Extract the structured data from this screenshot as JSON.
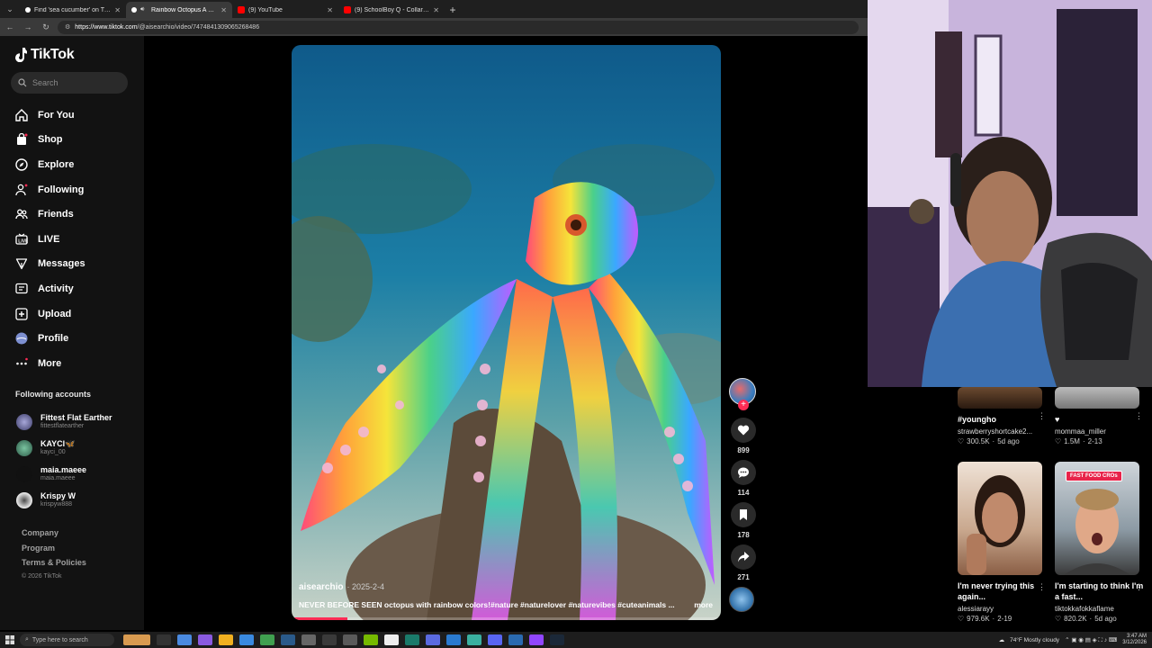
{
  "browser": {
    "tabs": [
      {
        "title": "Find 'sea cucumber' on TikTok | Ti",
        "color": "#111111"
      },
      {
        "title": "Rainbow Octopus A Nature Mo",
        "color": "#111111",
        "active": true
      },
      {
        "title": "(9) YouTube",
        "color": "#ff0000"
      },
      {
        "title": "(9) SchoolBoy Q - Collard Greens",
        "color": "#ff0000"
      }
    ],
    "url_host": "https://www.tiktok.com",
    "url_path": "/@aisearchio/video/7474841309065268486"
  },
  "tiktok": {
    "logo": "TikTok",
    "search_placeholder": "Search",
    "nav": [
      {
        "label": "For You",
        "icon": "home-icon"
      },
      {
        "label": "Shop",
        "icon": "shop-bag-icon"
      },
      {
        "label": "Explore",
        "icon": "compass-icon"
      },
      {
        "label": "Following",
        "icon": "user-follow-icon"
      },
      {
        "label": "Friends",
        "icon": "friends-icon"
      },
      {
        "label": "LIVE",
        "icon": "live-tv-icon"
      },
      {
        "label": "Messages",
        "icon": "messages-icon"
      },
      {
        "label": "Activity",
        "icon": "activity-icon"
      },
      {
        "label": "Upload",
        "icon": "upload-icon"
      },
      {
        "label": "Profile",
        "icon": "profile-avatar"
      },
      {
        "label": "More",
        "icon": "more-dots-icon"
      }
    ],
    "following_heading": "Following accounts",
    "accounts": [
      {
        "name": "Fittest Flat Earther",
        "handle": "fittestflatearther",
        "color": "#6a6a9a"
      },
      {
        "name": "KAYCI🦋",
        "handle": "kayci_00",
        "color": "#4a8a6a"
      },
      {
        "name": "maia.maeee",
        "handle": "maia.maeee",
        "color": "#2a2a2a"
      },
      {
        "name": "Krispy W",
        "handle": "krispyw888",
        "color": "#cfcfcf"
      }
    ],
    "footer": [
      "Company",
      "Program",
      "Terms & Policies"
    ],
    "copyright": "© 2026 TikTok"
  },
  "video": {
    "author": "aisearchio",
    "date": "· 2025-2-4",
    "description": "NEVER BEFORE SEEN octopus with rainbow colors!#nature #naturelover #naturevibes #cuteanimals ...",
    "more": "more",
    "progress": 0.13,
    "likes": "899",
    "comments": "114",
    "saves": "178",
    "shares": "271"
  },
  "suggested": [
    {
      "title": "#youngho",
      "user": "strawberryshortcake2...",
      "views": "300.5K",
      "age": "5d ago"
    },
    {
      "title": "♥",
      "user": "mommaa_miller",
      "views": "1.5M",
      "age": "2-13"
    },
    {
      "title": "I'm never trying this again...",
      "user": "alessiarayy",
      "views": "979.6K",
      "age": "2-19"
    },
    {
      "title": "I'm starting to think I'm a fast...",
      "user": "tiktokkafokkaflame",
      "views": "820.2K",
      "age": "5d ago",
      "tag": "FAST FOOD CROs"
    }
  ],
  "taskbar": {
    "search_placeholder": "Type here to search",
    "weather": "74°F  Mostly cloudy",
    "time": "3:47 AM",
    "date": "3/12/2026"
  }
}
